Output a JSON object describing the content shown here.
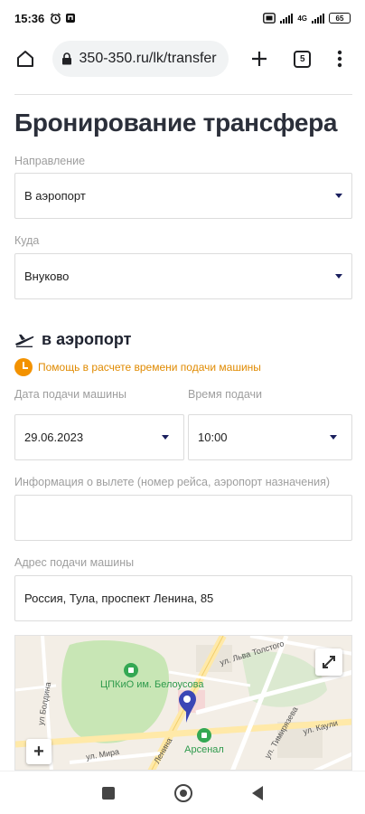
{
  "status_bar": {
    "time": "15:36",
    "left_icons": [
      "alarm-icon",
      "notification-icon"
    ],
    "right_icons": [
      "screen-record-icon",
      "signal-icon",
      "signal-icon",
      "battery-icon"
    ],
    "network": "4G",
    "battery": "65"
  },
  "browser": {
    "url": "350-350.ru/lk/transfer",
    "tabs_count": "5",
    "icons": [
      "home-icon",
      "lock-icon",
      "plus-icon",
      "tabs-icon",
      "more-vert-icon"
    ]
  },
  "page": {
    "title": "Бронирование трансфера",
    "direction_label": "Направление",
    "direction_value": "В аэропорт",
    "destination_label": "Куда",
    "destination_value": "Внуково",
    "section_title": "в аэропорт",
    "section_icon": "airplane-icon",
    "help_text": "Помощь в расчете времени подачи машины",
    "help_icon": "clock-icon",
    "date_label": "Дата подачи машины",
    "date_value": "29.06.2023",
    "time_label": "Время подачи",
    "time_value": "10:00",
    "flight_label": "Информация о вылете (номер рейса, аэропорт назначения)",
    "flight_value": "",
    "address_label": "Адрес подачи машины",
    "address_value": "Россия, Тула, проспект Ленина, 85"
  },
  "map": {
    "labels": {
      "street1": "ул. Льва Толстого",
      "street2": "ул Болдина",
      "street3": "ул. Тимирязева",
      "street4": "ул. Каули",
      "street5": "ул. Мира",
      "street6": "Ленина"
    },
    "poi1": "ЦПКиО им. Белоусова",
    "poi2": "Арсенал",
    "zoom_in": "+",
    "colors": {
      "park": "#c8e6b5",
      "road": "#ffe9a8",
      "pin": "#3b46b5"
    }
  },
  "navbar": {
    "icons": [
      "recents-icon",
      "home-circle-icon",
      "back-icon"
    ]
  }
}
